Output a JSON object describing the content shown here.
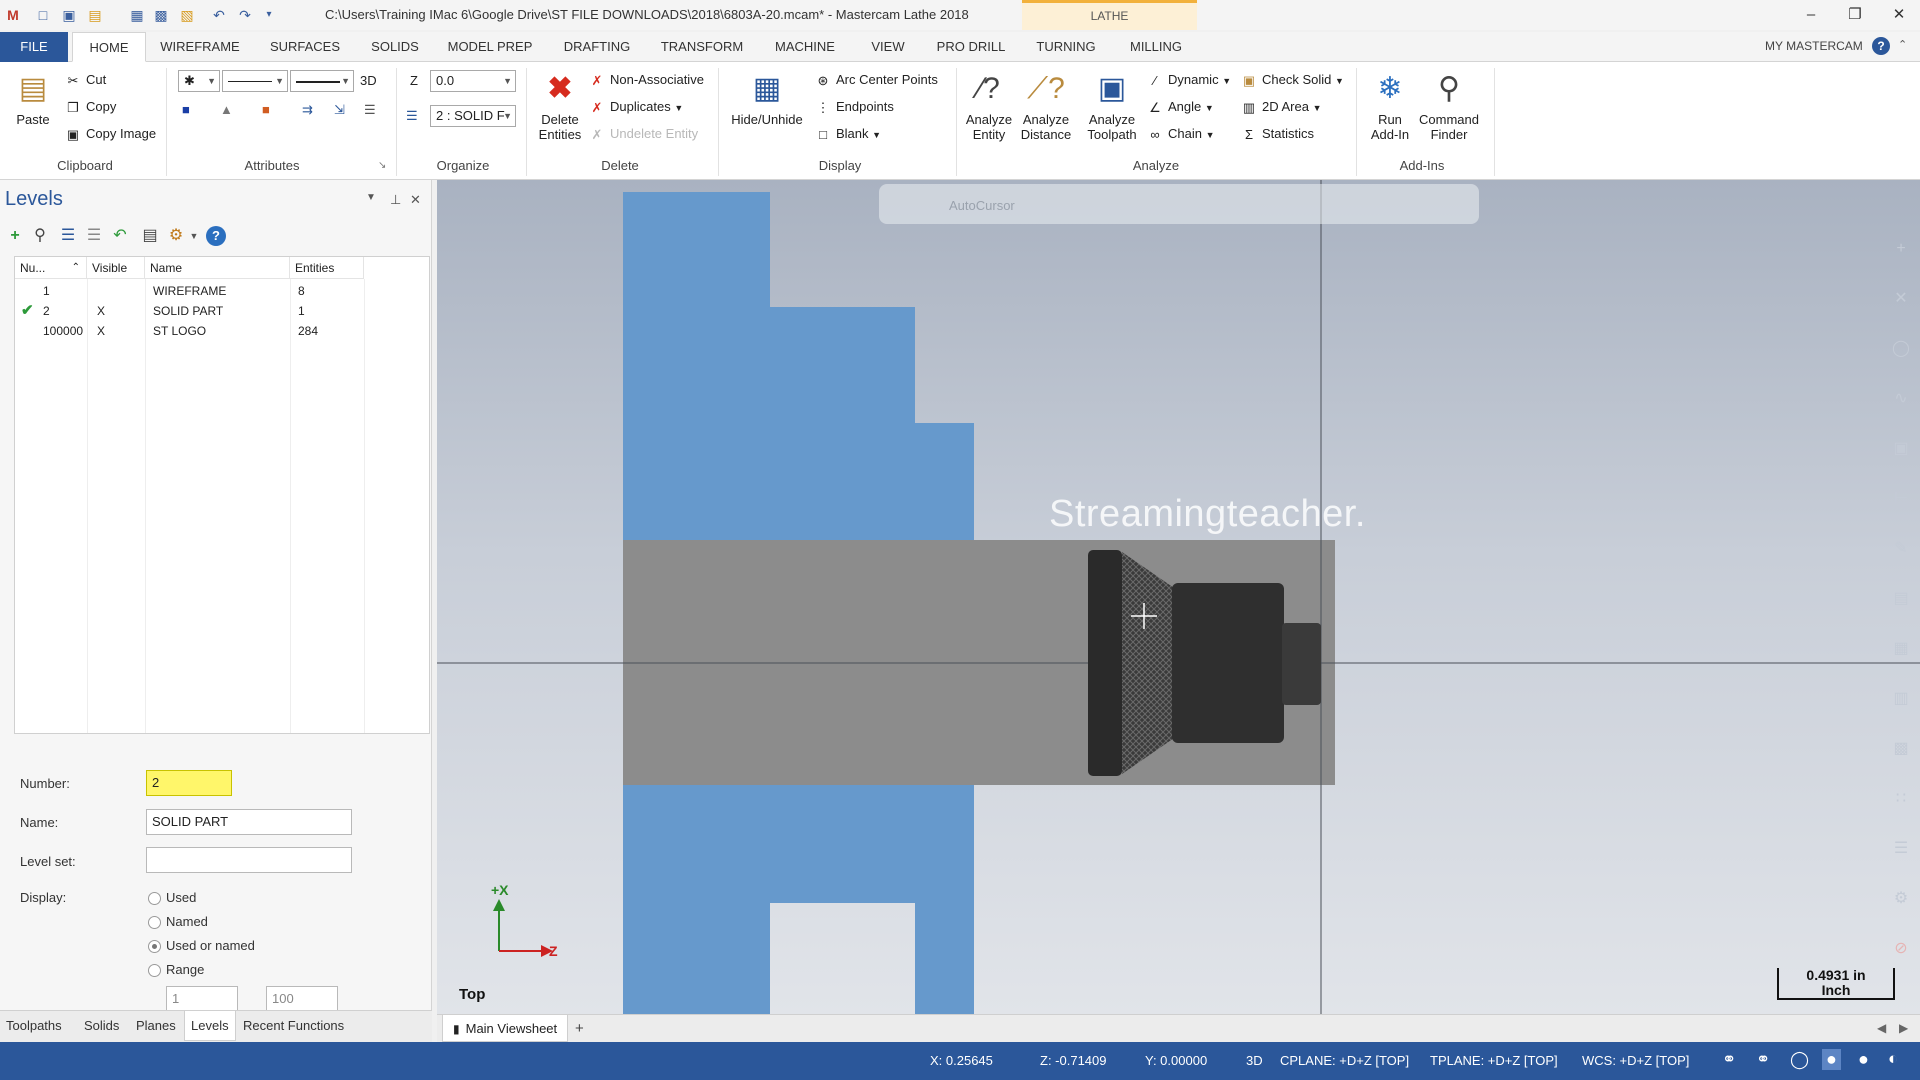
{
  "title_bar": {
    "app_title": "C:\\Users\\Training IMac 6\\Google Drive\\ST FILE DOWNLOADS\\2018\\6803A-20.mcam* - Mastercam Lathe 2018",
    "context_tab": "LATHE",
    "quick_access_icons": [
      "app-logo-icon",
      "new-file-icon",
      "save-icon",
      "open-icon",
      "print-icon",
      "save-as-icon",
      "merge-icon",
      "undo-icon",
      "redo-icon",
      "customize-icon"
    ]
  },
  "ribbon_tabs": [
    "FILE",
    "HOME",
    "WIREFRAME",
    "SURFACES",
    "SOLIDS",
    "MODEL PREP",
    "DRAFTING",
    "TRANSFORM",
    "MACHINE",
    "VIEW",
    "PRO DRILL",
    "TURNING",
    "MILLING"
  ],
  "active_tab": "HOME",
  "my_mastercam": "MY MASTERCAM",
  "ribbon": {
    "clipboard": {
      "label": "Clipboard",
      "paste": "Paste",
      "cut": "Cut",
      "copy": "Copy",
      "copy_image": "Copy Image"
    },
    "attributes": {
      "label": "Attributes",
      "mode_3d": "3D"
    },
    "organize": {
      "label": "Organize",
      "z_label": "Z",
      "z_value": "0.0",
      "level_value": "2 : SOLID F"
    },
    "delete": {
      "label": "Delete",
      "delete_entities": "Delete\nEntities",
      "non_associative": "Non-Associative",
      "duplicates": "Duplicates",
      "undelete": "Undelete Entity"
    },
    "display": {
      "label": "Display",
      "hide_unhide": "Hide/Unhide",
      "arc_center_points": "Arc Center Points",
      "endpoints": "Endpoints",
      "blank": "Blank"
    },
    "analyze": {
      "label": "Analyze",
      "analyze_entity": "Analyze\nEntity",
      "analyze_distance": "Analyze\nDistance",
      "analyze_toolpath": "Analyze\nToolpath",
      "dynamic": "Dynamic",
      "angle": "Angle",
      "chain": "Chain",
      "check_solid": "Check Solid",
      "area_2d": "2D Area",
      "statistics": "Statistics"
    },
    "addins": {
      "label": "Add-Ins",
      "run_addin": "Run\nAdd-In",
      "command_finder": "Command\nFinder"
    }
  },
  "levels_panel": {
    "title": "Levels",
    "columns": [
      "Nu...",
      "Visible",
      "Name",
      "Entities"
    ],
    "rows": [
      {
        "number": "1",
        "visible": "",
        "name": "WIREFRAME",
        "entities": "8",
        "active": false
      },
      {
        "number": "2",
        "visible": "X",
        "name": "SOLID PART",
        "entities": "1",
        "active": true
      },
      {
        "number": "100000",
        "visible": "X",
        "name": "ST LOGO",
        "entities": "284",
        "active": false
      }
    ],
    "form": {
      "number_label": "Number:",
      "number_value": "2",
      "name_label": "Name:",
      "name_value": "SOLID PART",
      "level_set_label": "Level set:",
      "level_set_value": "",
      "display_label": "Display:",
      "display_options": [
        "Used",
        "Named",
        "Used or named",
        "Range"
      ],
      "selected_display": "Used or named",
      "range_from": "1",
      "range_to": "100"
    }
  },
  "panel_tabs": [
    "Toolpaths",
    "Solids",
    "Planes",
    "Levels",
    "Recent Functions"
  ],
  "active_panel_tab": "Levels",
  "viewport": {
    "autocursor": "AutoCursor",
    "watermark": "Streamingteacher.",
    "axis_x": "+X",
    "axis_z": "Z",
    "view_name": "Top",
    "scale_value": "0.4931 in",
    "scale_unit": "Inch",
    "colors": {
      "stock": "#6699cc",
      "part": "#8c8c8c",
      "tool": "#2a2a2a",
      "axis": "#2a8a2a",
      "axis_z": "#cc2222"
    }
  },
  "viewsheet": {
    "tab": "Main Viewsheet",
    "add": "+"
  },
  "status_bar": {
    "x": "X:  0.25645",
    "z": "Z:  -0.71409",
    "y": "Y:  0.00000",
    "mode": "3D",
    "cplane": "CPLANE: +D+Z [TOP]",
    "tplane": "TPLANE: +D+Z [TOP]",
    "wcs": "WCS: +D+Z [TOP]"
  }
}
